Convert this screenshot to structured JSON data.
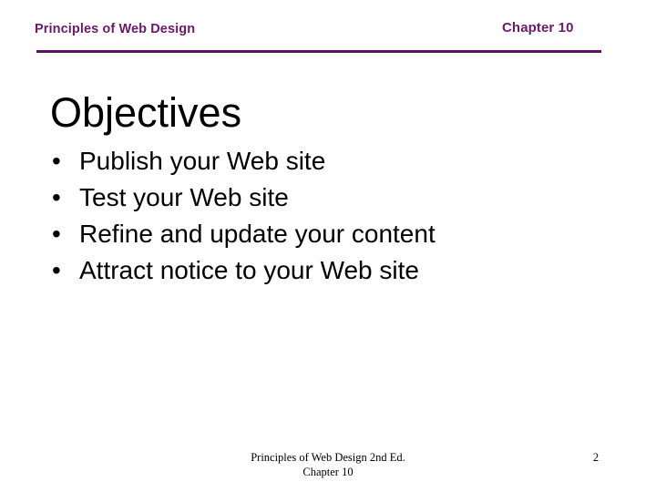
{
  "slide": {
    "background_color": "#ffffff",
    "accent_color": "#6B1A6B",
    "rule_color": "#5E125E",
    "text_color": "#000000"
  },
  "header": {
    "left_label": "Principles of Web Design",
    "right_label": "Chapter 10"
  },
  "title": "Objectives",
  "bullets": [
    {
      "marker": "•",
      "text": "Publish your Web site"
    },
    {
      "marker": "•",
      "text": "Test your Web site"
    },
    {
      "marker": "•",
      "text": "Refine and update your content"
    },
    {
      "marker": "•",
      "text": "Attract notice to your Web site"
    }
  ],
  "footer": {
    "line1": "Principles of Web Design 2nd Ed.",
    "line2": "Chapter 10",
    "page_number": "2"
  }
}
